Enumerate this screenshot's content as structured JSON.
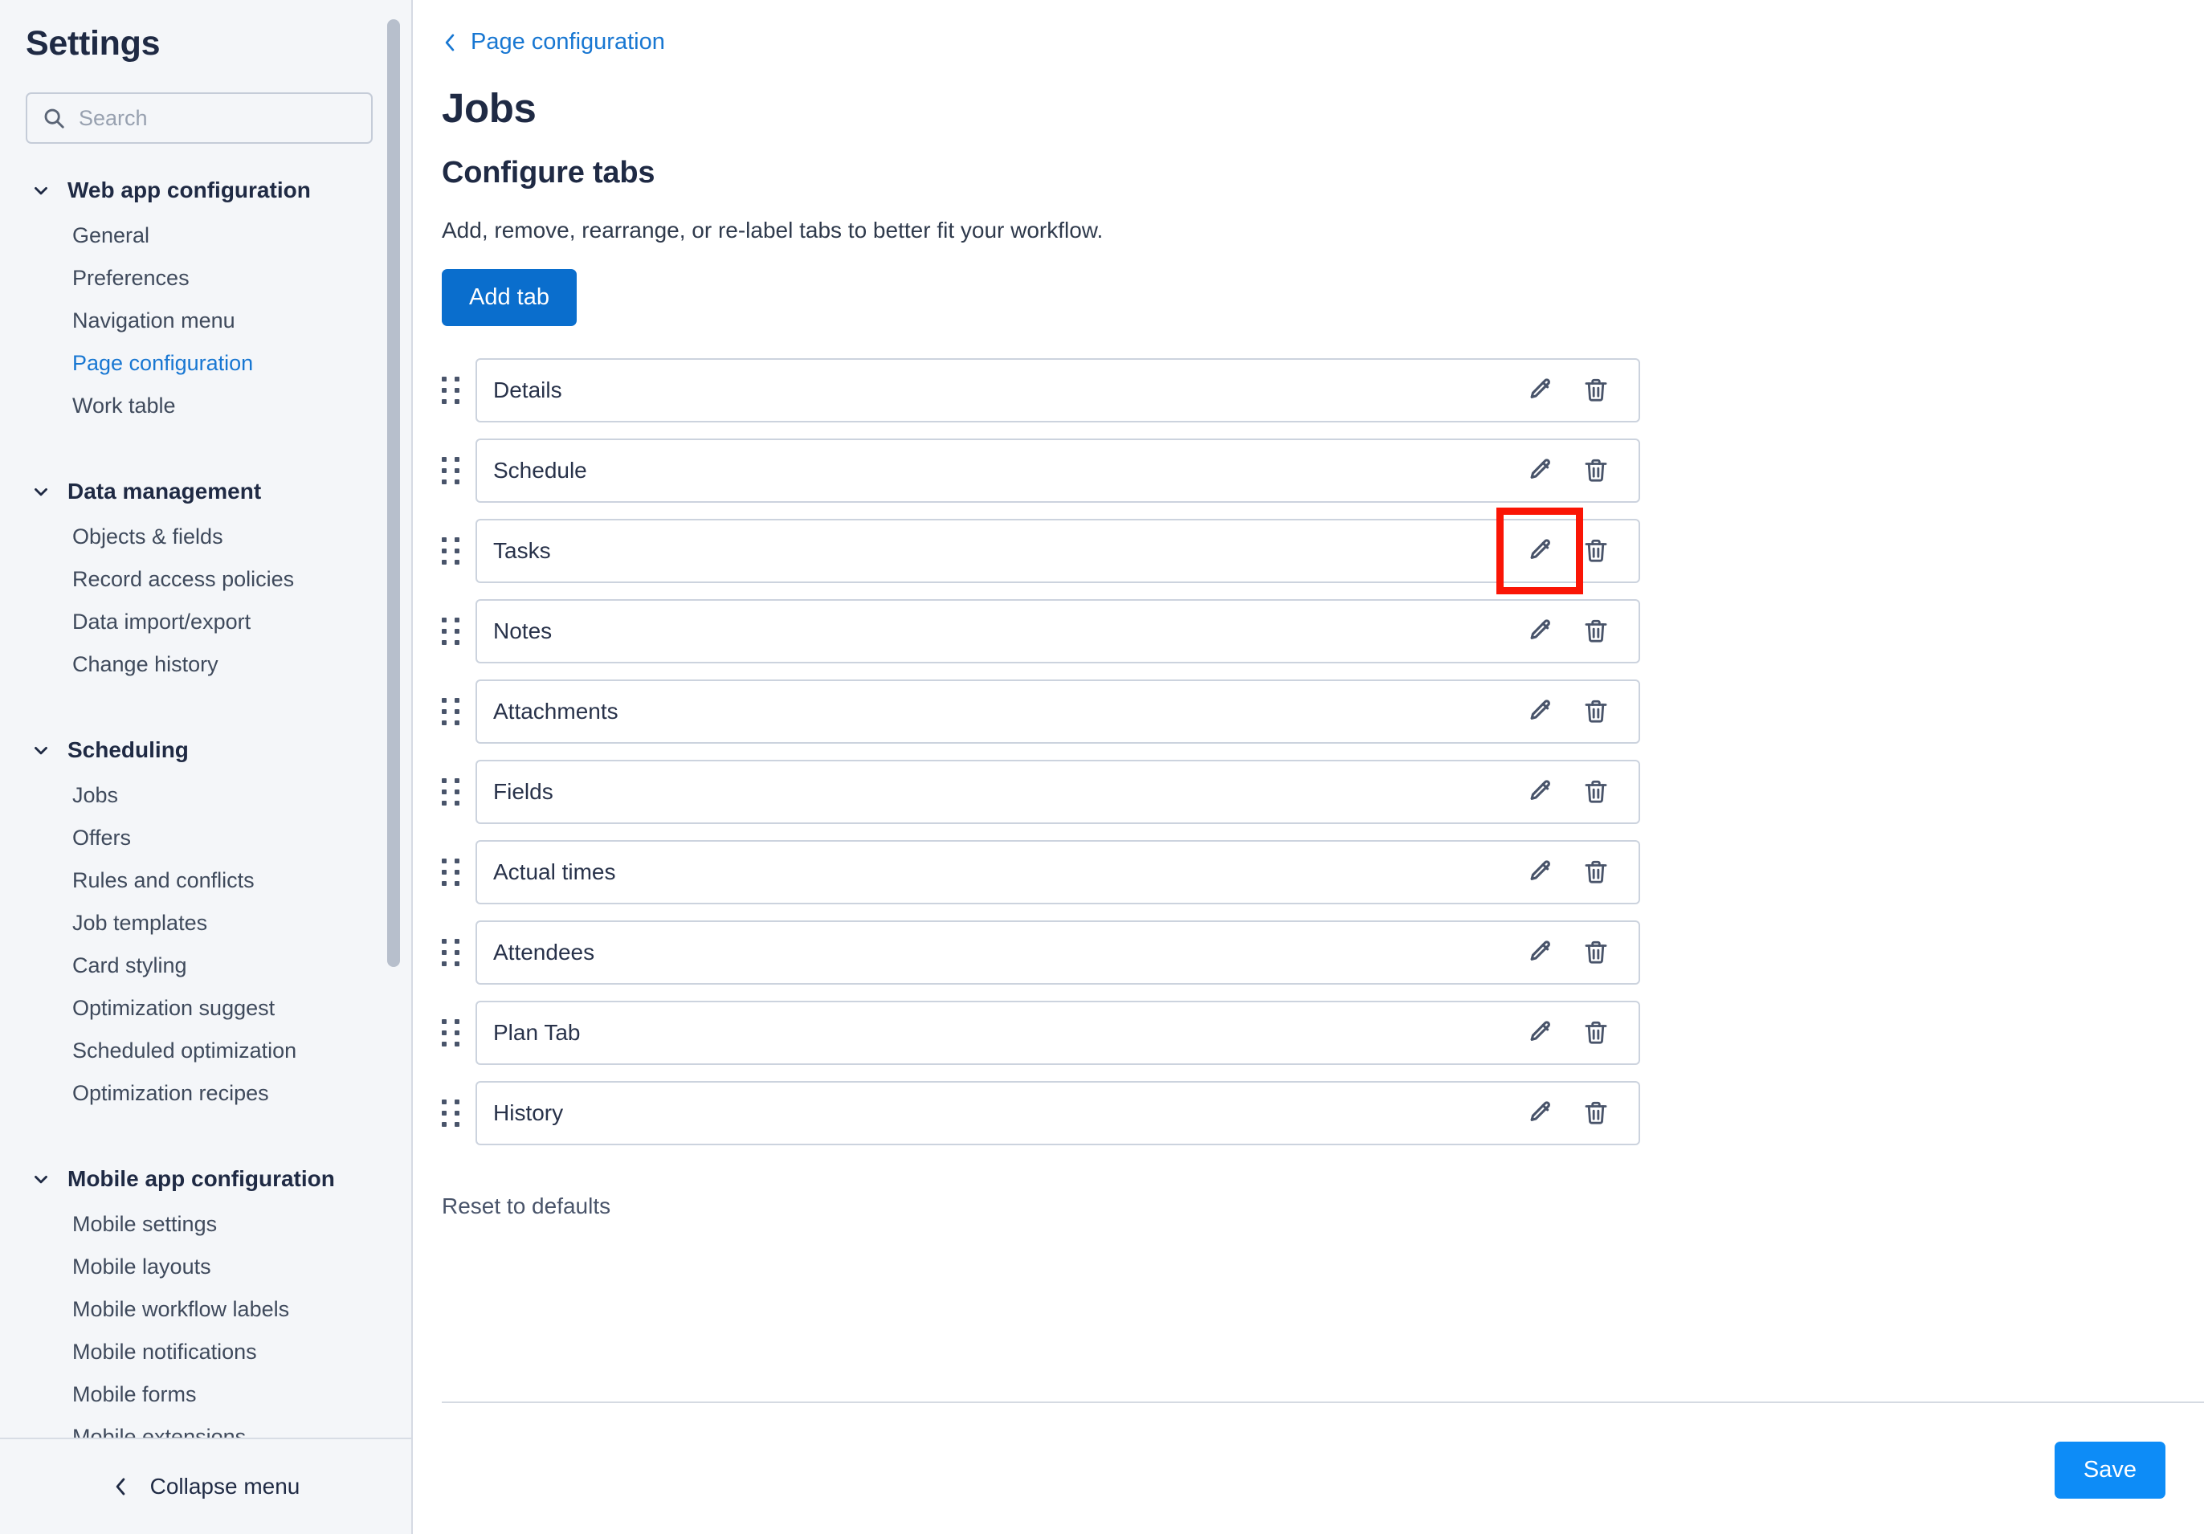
{
  "sidebar": {
    "title": "Settings",
    "search": {
      "placeholder": "Search",
      "value": ""
    },
    "groups": [
      {
        "label": "Web app configuration",
        "items": [
          {
            "label": "General",
            "active": false
          },
          {
            "label": "Preferences",
            "active": false
          },
          {
            "label": "Navigation menu",
            "active": false
          },
          {
            "label": "Page configuration",
            "active": true
          },
          {
            "label": "Work table",
            "active": false
          }
        ]
      },
      {
        "label": "Data management",
        "items": [
          {
            "label": "Objects & fields",
            "active": false
          },
          {
            "label": "Record access policies",
            "active": false
          },
          {
            "label": "Data import/export",
            "active": false
          },
          {
            "label": "Change history",
            "active": false
          }
        ]
      },
      {
        "label": "Scheduling",
        "items": [
          {
            "label": "Jobs",
            "active": false
          },
          {
            "label": "Offers",
            "active": false
          },
          {
            "label": "Rules and conflicts",
            "active": false
          },
          {
            "label": "Job templates",
            "active": false
          },
          {
            "label": "Card styling",
            "active": false
          },
          {
            "label": "Optimization suggest",
            "active": false
          },
          {
            "label": "Scheduled optimization",
            "active": false
          },
          {
            "label": "Optimization recipes",
            "active": false
          }
        ]
      },
      {
        "label": "Mobile app configuration",
        "items": [
          {
            "label": "Mobile settings",
            "active": false
          },
          {
            "label": "Mobile layouts",
            "active": false
          },
          {
            "label": "Mobile workflow labels",
            "active": false
          },
          {
            "label": "Mobile notifications",
            "active": false
          },
          {
            "label": "Mobile forms",
            "active": false
          },
          {
            "label": "Mobile extensions",
            "active": false
          }
        ]
      }
    ],
    "collapse_label": "Collapse menu"
  },
  "main": {
    "breadcrumb": "Page configuration",
    "page_title": "Jobs",
    "section_title": "Configure tabs",
    "section_description": "Add, remove, rearrange, or re-label tabs to better fit your workflow.",
    "add_tab_label": "Add tab",
    "reset_label": "Reset to defaults",
    "save_label": "Save",
    "tabs": [
      {
        "label": "Details",
        "highlighted": false
      },
      {
        "label": "Schedule",
        "highlighted": false
      },
      {
        "label": "Tasks",
        "highlighted": true
      },
      {
        "label": "Notes",
        "highlighted": false
      },
      {
        "label": "Attachments",
        "highlighted": false
      },
      {
        "label": "Fields",
        "highlighted": false
      },
      {
        "label": "Actual times",
        "highlighted": false
      },
      {
        "label": "Attendees",
        "highlighted": false
      },
      {
        "label": "Plan Tab",
        "highlighted": false
      },
      {
        "label": "History",
        "highlighted": false
      }
    ]
  },
  "icons": {
    "search": "search-icon",
    "chevron_down": "chevron-down-icon",
    "chevron_left": "chevron-left-icon",
    "drag": "drag-handle-icon",
    "edit": "pencil-edit-icon",
    "delete": "trash-delete-icon"
  },
  "colors": {
    "accent_link": "#1877d2",
    "add_button": "#0a6ecd",
    "save_button": "#0d8cf7",
    "highlight_annotation": "#fa1505",
    "sidebar_bg": "#f4f6f9",
    "text_dark": "#1f2a44"
  }
}
